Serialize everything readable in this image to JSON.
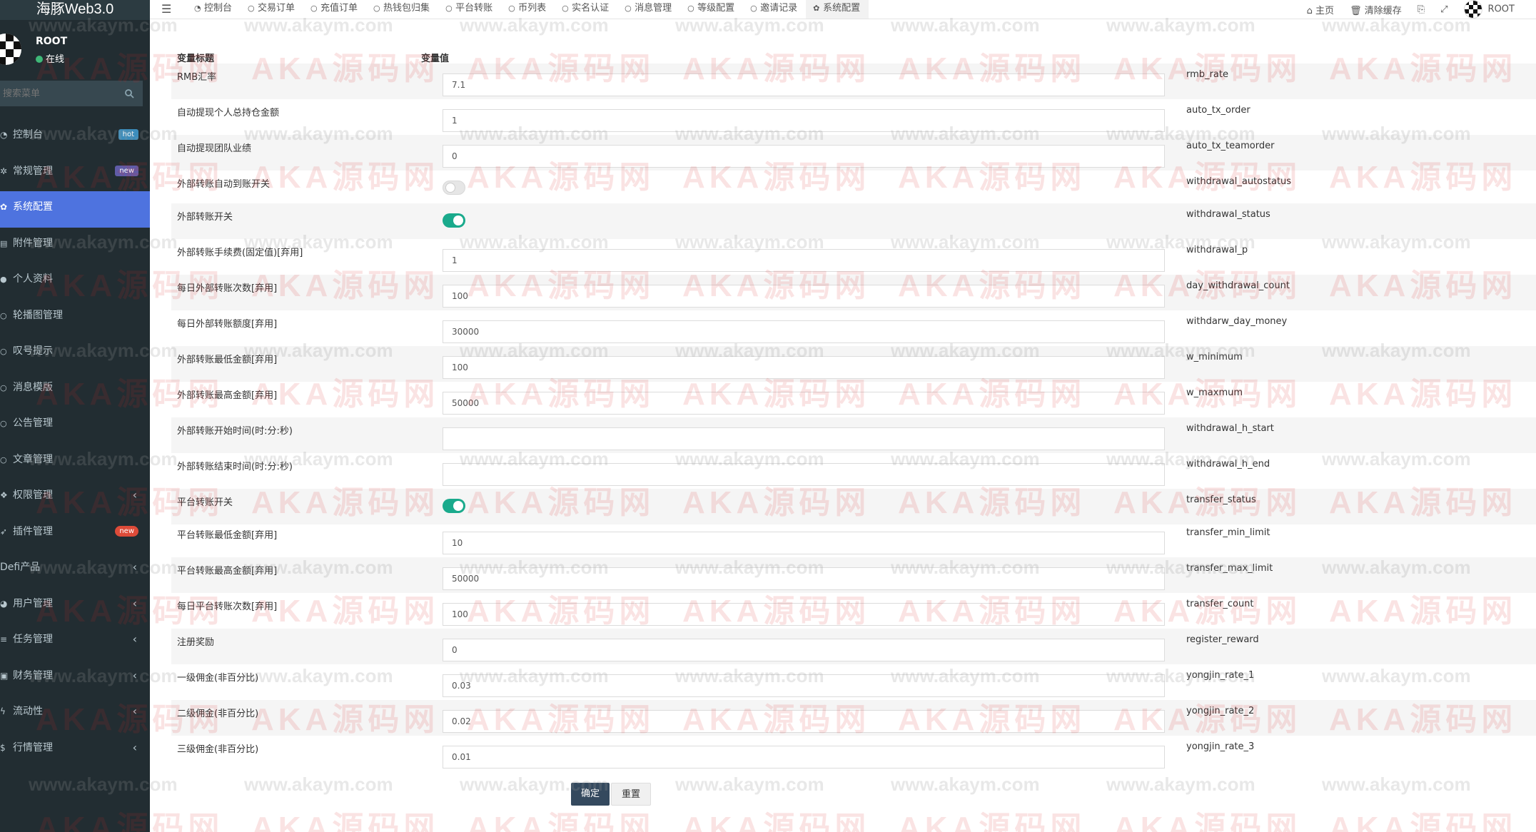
{
  "app": {
    "title": "海豚Web3.0"
  },
  "user": {
    "name": "ROOT",
    "status": "在线"
  },
  "search": {
    "placeholder": "搜索菜单"
  },
  "sidebar": {
    "items": [
      {
        "label": "控制台",
        "icon": "dashboard-icon",
        "badge": "hot"
      },
      {
        "label": "常规管理",
        "icon": "cogs-icon",
        "badge": "new"
      },
      {
        "label": "系统配置",
        "icon": "gear-icon",
        "active": true
      },
      {
        "label": "附件管理",
        "icon": "file-icon"
      },
      {
        "label": "个人资料",
        "icon": "user-icon"
      },
      {
        "label": "轮播图管理",
        "icon": "circle-icon"
      },
      {
        "label": "叹号提示",
        "icon": "circle-icon"
      },
      {
        "label": "消息模版",
        "icon": "circle-icon"
      },
      {
        "label": "公告管理",
        "icon": "circle-icon"
      },
      {
        "label": "文章管理",
        "icon": "circle-icon"
      },
      {
        "label": "权限管理",
        "icon": "group-icon"
      },
      {
        "label": "插件管理",
        "icon": "rocket-icon",
        "badge": "new"
      },
      {
        "label": "Defi产品",
        "icon": "defi-icon"
      },
      {
        "label": "用户管理",
        "icon": "users-icon"
      },
      {
        "label": "任务管理",
        "icon": "tasks-icon"
      },
      {
        "label": "财务管理",
        "icon": "money-icon"
      },
      {
        "label": "流动性",
        "icon": "bolt-icon"
      },
      {
        "label": "行情管理",
        "icon": "dollar-icon"
      }
    ]
  },
  "topbar": {
    "tabs": [
      {
        "label": "控制台",
        "icon": "dashboard-icon"
      },
      {
        "label": "交易订单",
        "icon": "circle-icon"
      },
      {
        "label": "充值订单",
        "icon": "circle-icon"
      },
      {
        "label": "热钱包归集",
        "icon": "circle-icon"
      },
      {
        "label": "平台转账",
        "icon": "circle-icon"
      },
      {
        "label": "币列表",
        "icon": "circle-icon"
      },
      {
        "label": "实名认证",
        "icon": "circle-icon"
      },
      {
        "label": "消息管理",
        "icon": "circle-icon"
      },
      {
        "label": "等级配置",
        "icon": "circle-icon"
      },
      {
        "label": "邀请记录",
        "icon": "circle-icon"
      },
      {
        "label": "系统配置",
        "icon": "gear-icon",
        "active": true
      }
    ],
    "home": "主页",
    "clear_cache": "清除缓存",
    "user": "ROOT"
  },
  "table": {
    "col_title": "变量标题",
    "col_value": "变量值",
    "rows": [
      {
        "label": "RMB汇率",
        "value": "7.1",
        "key": "rmb_rate",
        "type": "input"
      },
      {
        "label": "自动提现个人总持仓金额",
        "value": "1",
        "key": "auto_tx_order",
        "type": "input"
      },
      {
        "label": "自动提现团队业绩",
        "value": "0",
        "key": "auto_tx_teamorder",
        "type": "input"
      },
      {
        "label": "外部转账自动到账开关",
        "value": "off",
        "key": "withdrawal_autostatus",
        "type": "toggle"
      },
      {
        "label": "外部转账开关",
        "value": "on",
        "key": "withdrawal_status",
        "type": "toggle"
      },
      {
        "label": "外部转账手续费(固定值)[弃用]",
        "value": "1",
        "key": "withdrawal_p",
        "type": "input"
      },
      {
        "label": "每日外部转账次数[弃用]",
        "value": "100",
        "key": "day_withdrawal_count",
        "type": "input"
      },
      {
        "label": "每日外部转账额度[弃用]",
        "value": "30000",
        "key": "withdarw_day_money",
        "type": "input"
      },
      {
        "label": "外部转账最低金额[弃用]",
        "value": "100",
        "key": "w_minimum",
        "type": "input"
      },
      {
        "label": "外部转账最高金额[弃用]",
        "value": "50000",
        "key": "w_maxmum",
        "type": "input"
      },
      {
        "label": "外部转账开始时间(时:分:秒)",
        "value": "",
        "key": "withdrawal_h_start",
        "type": "input"
      },
      {
        "label": "外部转账结束时间(时:分:秒)",
        "value": "",
        "key": "withdrawal_h_end",
        "type": "input"
      },
      {
        "label": "平台转账开关",
        "value": "on",
        "key": "transfer_status",
        "type": "toggle"
      },
      {
        "label": "平台转账最低金额[弃用]",
        "value": "10",
        "key": "transfer_min_limit",
        "type": "input"
      },
      {
        "label": "平台转账最高金额[弃用]",
        "value": "50000",
        "key": "transfer_max_limit",
        "type": "input"
      },
      {
        "label": "每日平台转账次数[弃用]",
        "value": "100",
        "key": "transfer_count",
        "type": "input"
      },
      {
        "label": "注册奖励",
        "value": "0",
        "key": "register_reward",
        "type": "input"
      },
      {
        "label": "一级佣金(非百分比)",
        "value": "0.03",
        "key": "yongjin_rate_1",
        "type": "input"
      },
      {
        "label": "二级佣金(非百分比)",
        "value": "0.02",
        "key": "yongjin_rate_2",
        "type": "input"
      },
      {
        "label": "三级佣金(非百分比)",
        "value": "0.01",
        "key": "yongjin_rate_3",
        "type": "input"
      }
    ]
  },
  "buttons": {
    "ok": "确定",
    "reset": "重置"
  },
  "watermark": {
    "site": "www.akaym.com",
    "logo": "AKA源码网"
  },
  "colors": {
    "sidebar_bg": "#222d32",
    "active_menu": "#4e73df",
    "toggle_on": "#1aaa8c",
    "ok_button": "#34495e"
  }
}
